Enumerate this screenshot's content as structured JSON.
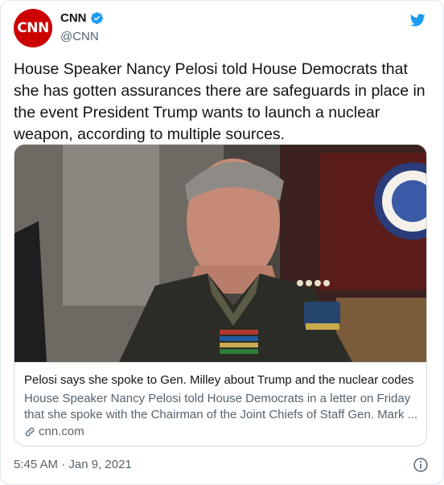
{
  "header": {
    "avatar_text": "CNN",
    "display_name": "CNN",
    "handle": "@CNN",
    "verified": true,
    "icons": [
      "verified-badge-icon",
      "twitter-bird-icon"
    ]
  },
  "tweet": {
    "text": "House Speaker Nancy Pelosi told House Democrats that she has gotten assurances there are safeguards in place in the event President Trump wants to launch a nuclear weapon, according to multiple sources."
  },
  "card": {
    "image_alt": "General in military uniform",
    "title": "Pelosi says she spoke to Gen. Milley about Trump and the nuclear codes",
    "description_line1": "House Speaker Nancy Pelosi told House Democrats in a letter on Friday",
    "description_line2": "that she spoke with the Chairman of the Joint Chiefs of Staff Gen. Mark ...",
    "domain": "cnn.com",
    "domain_icon": "link-icon"
  },
  "footer": {
    "timestamp": "5:45 AM · Jan 9, 2021",
    "info_icon": "info-icon"
  },
  "colors": {
    "brand_red": "#cc0000",
    "twitter_blue": "#1d9bf0",
    "text_primary": "#0f1419",
    "text_secondary": "#536471",
    "border": "#cfd9de"
  }
}
